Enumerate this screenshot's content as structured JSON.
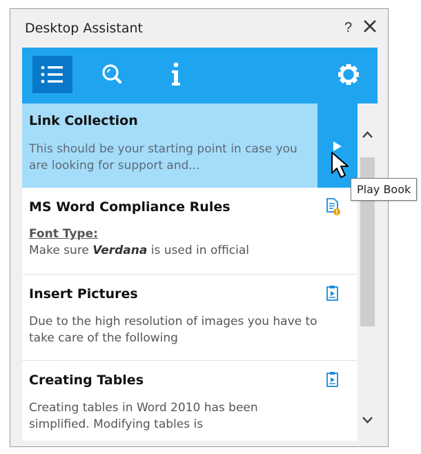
{
  "window": {
    "title": "Desktop Assistant",
    "help_label": "?",
    "close_icon": "close-icon"
  },
  "toolbar": {
    "buttons": [
      {
        "name": "list-icon",
        "active": true
      },
      {
        "name": "search-icon",
        "active": false
      },
      {
        "name": "info-icon",
        "active": false
      },
      {
        "name": "gear-icon",
        "active": false
      }
    ],
    "accent": "#1fa4f0",
    "active_bg": "#0a78c9"
  },
  "items": [
    {
      "title": "Link Collection",
      "desc": "This should be your starting point in case you are looking for support and...",
      "selected": true,
      "action_icon": "play-icon"
    },
    {
      "title": "MS Word Compliance Rules",
      "label": "Font Type:",
      "desc_pre": "Make sure ",
      "desc_em": "Verdana",
      "desc_post": " is used in official",
      "icon": "document-warning-icon"
    },
    {
      "title": "Insert Pictures",
      "desc": "Due to the high resolution of images you have to take care of the following",
      "icon": "playbook-icon"
    },
    {
      "title": "Creating Tables",
      "desc": "Creating tables in Word 2010 has been simplified. Modifying tables is",
      "icon": "playbook-icon"
    }
  ],
  "tooltip": {
    "text": "Play Book"
  },
  "colors": {
    "selected_bg": "#a5dcf9",
    "warning": "#e8a000"
  }
}
